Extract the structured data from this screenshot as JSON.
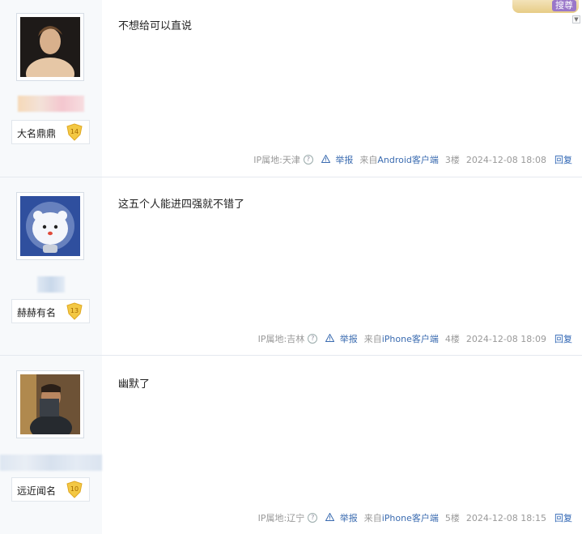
{
  "toolbar": {
    "search_label": "搜尊"
  },
  "posts": [
    {
      "username": "大名鼎鼎",
      "level": "14",
      "content": "不想给可以直说",
      "ip_label": "IP属地:天津",
      "report_label": "举报",
      "from_label": "来自",
      "client_label": "Android客户端",
      "floor": "3楼",
      "time": "2024-12-08 18:08",
      "reply_label": "回复"
    },
    {
      "username": "赫赫有名",
      "level": "13",
      "content": "这五个人能进四强就不错了",
      "ip_label": "IP属地:吉林",
      "report_label": "举报",
      "from_label": "来自",
      "client_label": "iPhone客户端",
      "floor": "4楼",
      "time": "2024-12-08 18:09",
      "reply_label": "回复"
    },
    {
      "username": "远近闻名",
      "level": "10",
      "content": "幽默了",
      "ip_label": "IP属地:辽宁",
      "report_label": "举报",
      "from_label": "来自",
      "client_label": "iPhone客户端",
      "floor": "5楼",
      "time": "2024-12-08 18:15",
      "reply_label": "回复"
    }
  ],
  "colors": {
    "link": "#3a6bb0",
    "badge_gold": "#f3c844",
    "sidebar_bg": "#f7f9fb"
  }
}
